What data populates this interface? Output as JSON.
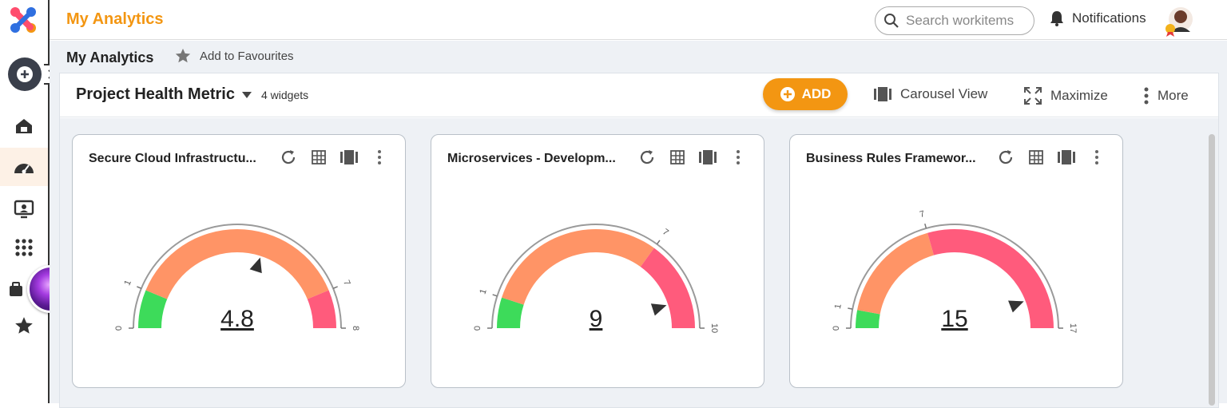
{
  "app": {
    "title": "My Analytics"
  },
  "search": {
    "placeholder": "Search workitems"
  },
  "header": {
    "notifications_label": "Notifications"
  },
  "breadcrumb": {
    "current": "My Analytics",
    "favourite_label": "Add to Favourites"
  },
  "dashboard": {
    "title": "Project Health Metric",
    "widget_count": "4 widgets",
    "add_label": "ADD",
    "carousel_label": "Carousel View",
    "maximize_label": "Maximize",
    "more_label": "More"
  },
  "rail_icons": [
    "home-icon",
    "dashboard-gauge-icon",
    "presentation-icon",
    "apps-grid-icon",
    "work-icon",
    "star-icon"
  ],
  "colors": {
    "accent": "#f39612",
    "green": "#3ddb5a",
    "orange": "#ff9466",
    "pink": "#ff5b7c"
  },
  "chart_data": [
    {
      "type": "gauge",
      "title": "Secure Cloud Infrastructu...",
      "min": 0,
      "max": 8,
      "value": 4.8,
      "bands": [
        {
          "from": 0,
          "to": 1,
          "color": "green"
        },
        {
          "from": 1,
          "to": 7,
          "color": "orange"
        },
        {
          "from": 7,
          "to": 8,
          "color": "pink"
        }
      ],
      "tick_labels": [
        "0",
        "1",
        "7",
        "8"
      ],
      "value_label": "4.8"
    },
    {
      "type": "gauge",
      "title": "Microservices - Developm...",
      "min": 0,
      "max": 10,
      "value": 9,
      "bands": [
        {
          "from": 0,
          "to": 1,
          "color": "green"
        },
        {
          "from": 1,
          "to": 7,
          "color": "orange"
        },
        {
          "from": 7,
          "to": 10,
          "color": "pink"
        }
      ],
      "tick_labels": [
        "0",
        "1",
        "7",
        "10"
      ],
      "value_label": "9"
    },
    {
      "type": "gauge",
      "title": "Business Rules Framewor...",
      "min": 0,
      "max": 17,
      "value": 15,
      "bands": [
        {
          "from": 0,
          "to": 1,
          "color": "green"
        },
        {
          "from": 1,
          "to": 7,
          "color": "orange"
        },
        {
          "from": 7,
          "to": 17,
          "color": "pink"
        }
      ],
      "tick_labels": [
        "0",
        "1",
        "7",
        "17"
      ],
      "value_label": "15"
    }
  ]
}
